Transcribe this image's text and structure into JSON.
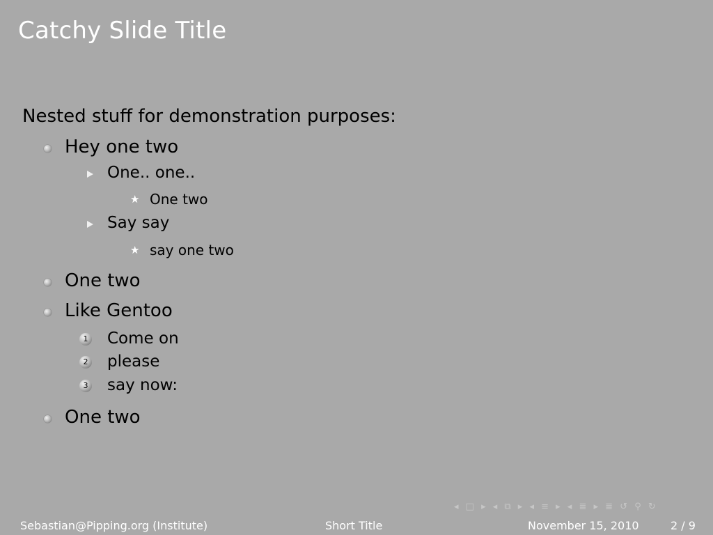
{
  "slide": {
    "title": "Catchy Slide Title",
    "intro": "Nested stuff for demonstration purposes:",
    "items": {
      "i1": "Hey one two",
      "i1a": "One.. one..",
      "i1a1": "One two",
      "i1b": "Say say",
      "i1b1": "say one two",
      "i2": "One two",
      "i3": "Like Gentoo",
      "i3n1": "Come on",
      "i3n2": "please",
      "i3n3": "say now:",
      "i4": "One two"
    },
    "numbers": {
      "n1": "1",
      "n2": "2",
      "n3": "3"
    }
  },
  "footer": {
    "author": "Sebastian@Pipping.org  (Institute)",
    "short_title": "Short Title",
    "date": "November 15, 2010",
    "page": "2 / 9"
  },
  "nav": {
    "symbols": "◂ □ ▸ ◂ ⧉ ▸ ◂ ≡ ▸ ◂ ≣ ▸   ≣   ↺ ⚲ ↻"
  },
  "colors": {
    "background": "#a9a9a9",
    "title_text": "#ffffff"
  }
}
